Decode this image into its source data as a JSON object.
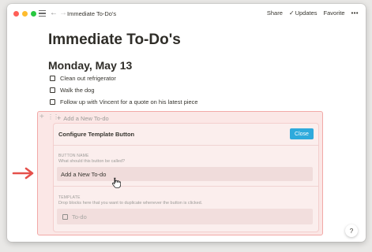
{
  "titlebar": {
    "breadcrumb": "Immediate To-Do's",
    "share_label": "Share",
    "updates_label": "Updates",
    "favorite_label": "Favorite",
    "more_label": "•••"
  },
  "page": {
    "title": "Immediate To-Do's",
    "date_heading": "Monday, May 13",
    "todos": [
      {
        "label": "Clean out refrigerator",
        "checked": false
      },
      {
        "label": "Walk the dog",
        "checked": false
      },
      {
        "label": "Follow up with Vincent for a quote on his latest piece",
        "checked": false
      }
    ]
  },
  "template_button": {
    "label": "Add a New To-do"
  },
  "config_panel": {
    "title": "Configure Template Button",
    "close_label": "Close",
    "button_name": {
      "label": "BUTTON NAME",
      "help": "What should this button be called?",
      "value": "Add a New To-do"
    },
    "template": {
      "label": "TEMPLATE",
      "help": "Drop blocks here that you want to duplicate whenever the button is clicked.",
      "todo_placeholder": "To-do"
    }
  },
  "help_button_label": "?",
  "colors": {
    "highlight_bg": "#fbe7e6",
    "highlight_border": "#f2a9a7",
    "close_button": "#2eaadc",
    "arrow": "#e5504b"
  },
  "icons": [
    "hamburger-icon",
    "back-arrow-icon",
    "forward-arrow-icon",
    "checkmark-icon",
    "plus-icon",
    "drag-handle-icon",
    "hand-cursor-icon",
    "red-arrow-icon",
    "help-icon"
  ]
}
